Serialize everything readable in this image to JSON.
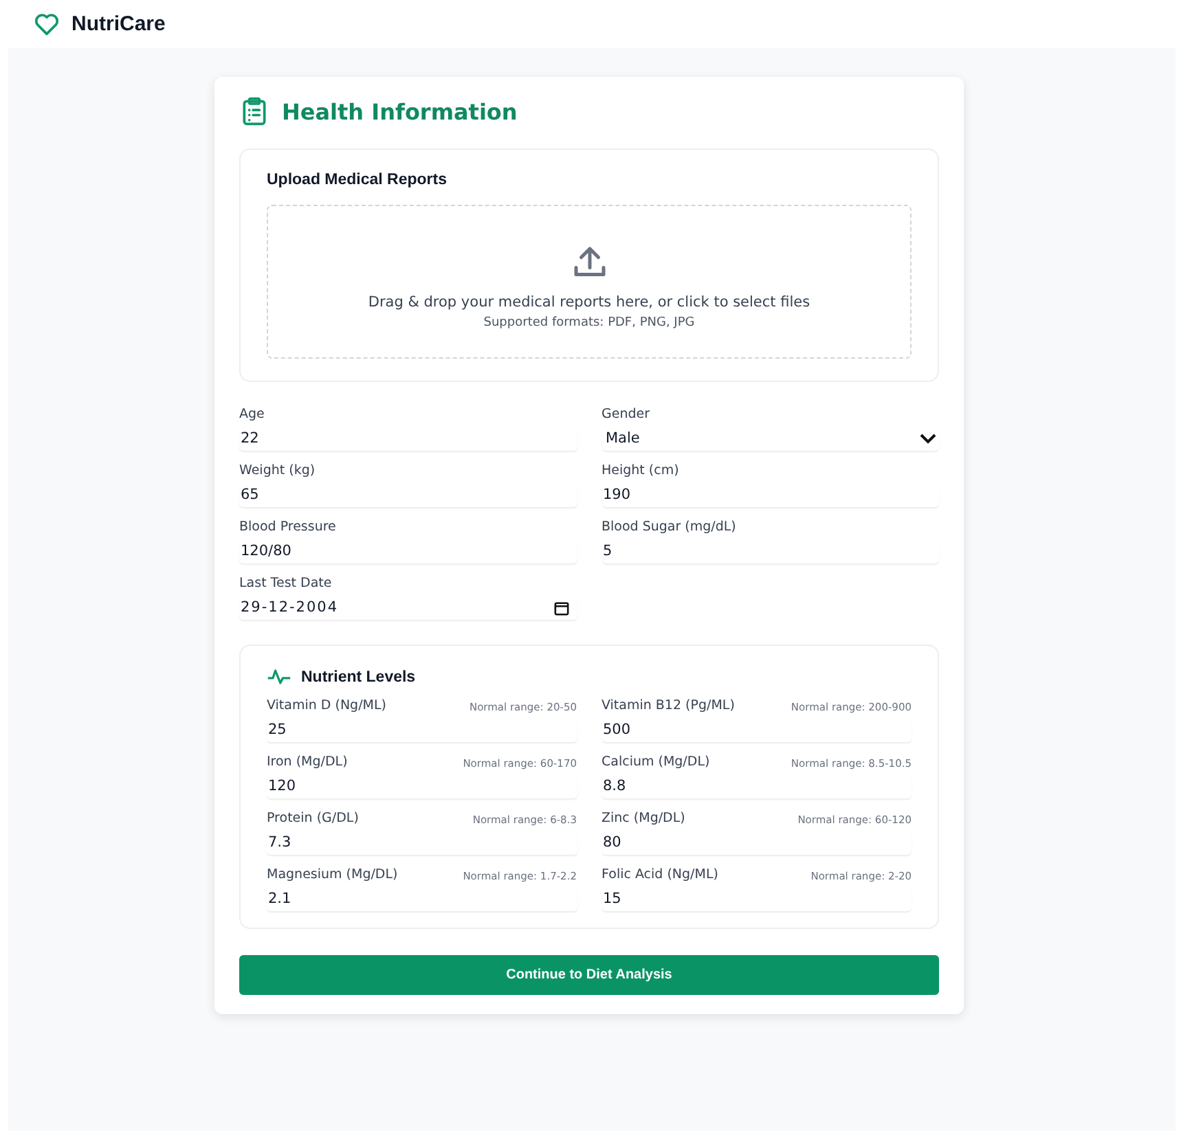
{
  "app": {
    "name": "NutriCare"
  },
  "form": {
    "title": "Health Information",
    "upload": {
      "title": "Upload Medical Reports",
      "prompt": "Drag & drop your medical reports here, or click to select files",
      "formats": "Supported formats: PDF, PNG, JPG"
    },
    "fields": [
      {
        "kind": "text",
        "label": "Age",
        "value": "22"
      },
      {
        "kind": "select",
        "label": "Gender",
        "value": "Male"
      },
      {
        "kind": "text",
        "label": "Weight (kg)",
        "value": "65"
      },
      {
        "kind": "text",
        "label": "Height (cm)",
        "value": "190"
      },
      {
        "kind": "text",
        "label": "Blood Pressure",
        "value": "120/80"
      },
      {
        "kind": "text",
        "label": "Blood Sugar (mg/dL)",
        "value": "5"
      },
      {
        "kind": "date",
        "label": "Last Test Date",
        "value": "29-12-2004"
      }
    ],
    "nutrients": {
      "title": "Nutrient Levels",
      "items": [
        {
          "name": "Vitamin D (Ng/ML)",
          "range": "Normal range: 20-50",
          "value": "25"
        },
        {
          "name": "Vitamin B12 (Pg/ML)",
          "range": "Normal range: 200-900",
          "value": "500"
        },
        {
          "name": "Iron (Mg/DL)",
          "range": "Normal range: 60-170",
          "value": "120"
        },
        {
          "name": "Calcium (Mg/DL)",
          "range": "Normal range: 8.5-10.5",
          "value": "8.8"
        },
        {
          "name": "Protein (G/DL)",
          "range": "Normal range: 6-8.3",
          "value": "7.3"
        },
        {
          "name": "Zinc (Mg/DL)",
          "range": "Normal range: 60-120",
          "value": "80"
        },
        {
          "name": "Magnesium (Mg/DL)",
          "range": "Normal range: 1.7-2.2",
          "value": "2.1"
        },
        {
          "name": "Folic Acid (Ng/ML)",
          "range": "Normal range: 2-20",
          "value": "15"
        }
      ]
    },
    "submit": "Continue to Diet Analysis"
  }
}
